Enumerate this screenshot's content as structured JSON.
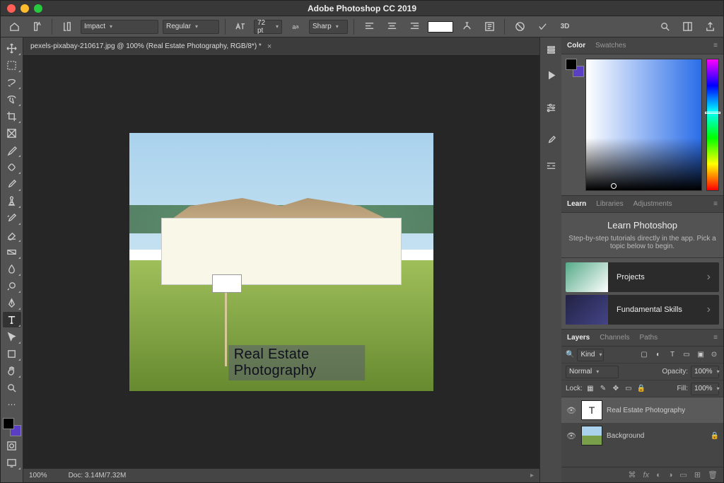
{
  "title": "Adobe Photoshop CC 2019",
  "opts": {
    "font": "Impact",
    "weight": "Regular",
    "size_label": "T",
    "size": "72 pt",
    "aa": "Sharp",
    "three_d": "3D"
  },
  "document": {
    "tab": "pexels-pixabay-210617.jpg @ 100% (Real Estate Photography, RGB/8*) *",
    "watermark": "Real Estate Photography"
  },
  "status": {
    "zoom": "100%",
    "doc": "Doc: 3.14M/7.32M"
  },
  "color_panel": {
    "tabs": [
      "Color",
      "Swatches"
    ]
  },
  "learn": {
    "tabs": [
      "Learn",
      "Libraries",
      "Adjustments"
    ],
    "title": "Learn Photoshop",
    "sub": "Step-by-step tutorials directly in the app. Pick a topic below to begin.",
    "cards": [
      "Projects",
      "Fundamental Skills"
    ]
  },
  "layers": {
    "tabs": [
      "Layers",
      "Channels",
      "Paths"
    ],
    "filter_label": "Kind",
    "blend": "Normal",
    "opacity_label": "Opacity:",
    "opacity": "100%",
    "lock_label": "Lock:",
    "fill_label": "Fill:",
    "fill": "100%",
    "items": [
      {
        "name": "Real Estate Photography",
        "type": "T"
      },
      {
        "name": "Background"
      }
    ]
  }
}
